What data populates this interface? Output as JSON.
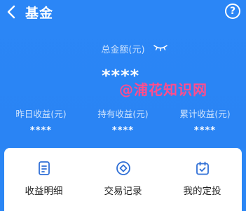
{
  "header": {
    "back_icon": "chevron-left-icon",
    "title": "基金",
    "help_label": "?"
  },
  "summary": {
    "total_label": "总金额(元)",
    "total_value": "****",
    "eye_icon": "eye-closed-icon"
  },
  "watermark": "@浦花知识网",
  "stats": [
    {
      "label": "昨日收益(元)",
      "value": "****"
    },
    {
      "label": "持有收益(元)",
      "value": "****"
    },
    {
      "label": "累计收益(元)",
      "value": "****"
    }
  ],
  "actions": [
    {
      "label": "收益明细",
      "icon": "document-icon"
    },
    {
      "label": "交易记录",
      "icon": "diamond-circle-icon"
    },
    {
      "label": "我的定投",
      "icon": "calendar-check-icon"
    }
  ],
  "colors": {
    "primary_blue": "#2a86f5",
    "icon_blue": "#2f6fd6",
    "watermark_pink": "#ff4d8e"
  }
}
